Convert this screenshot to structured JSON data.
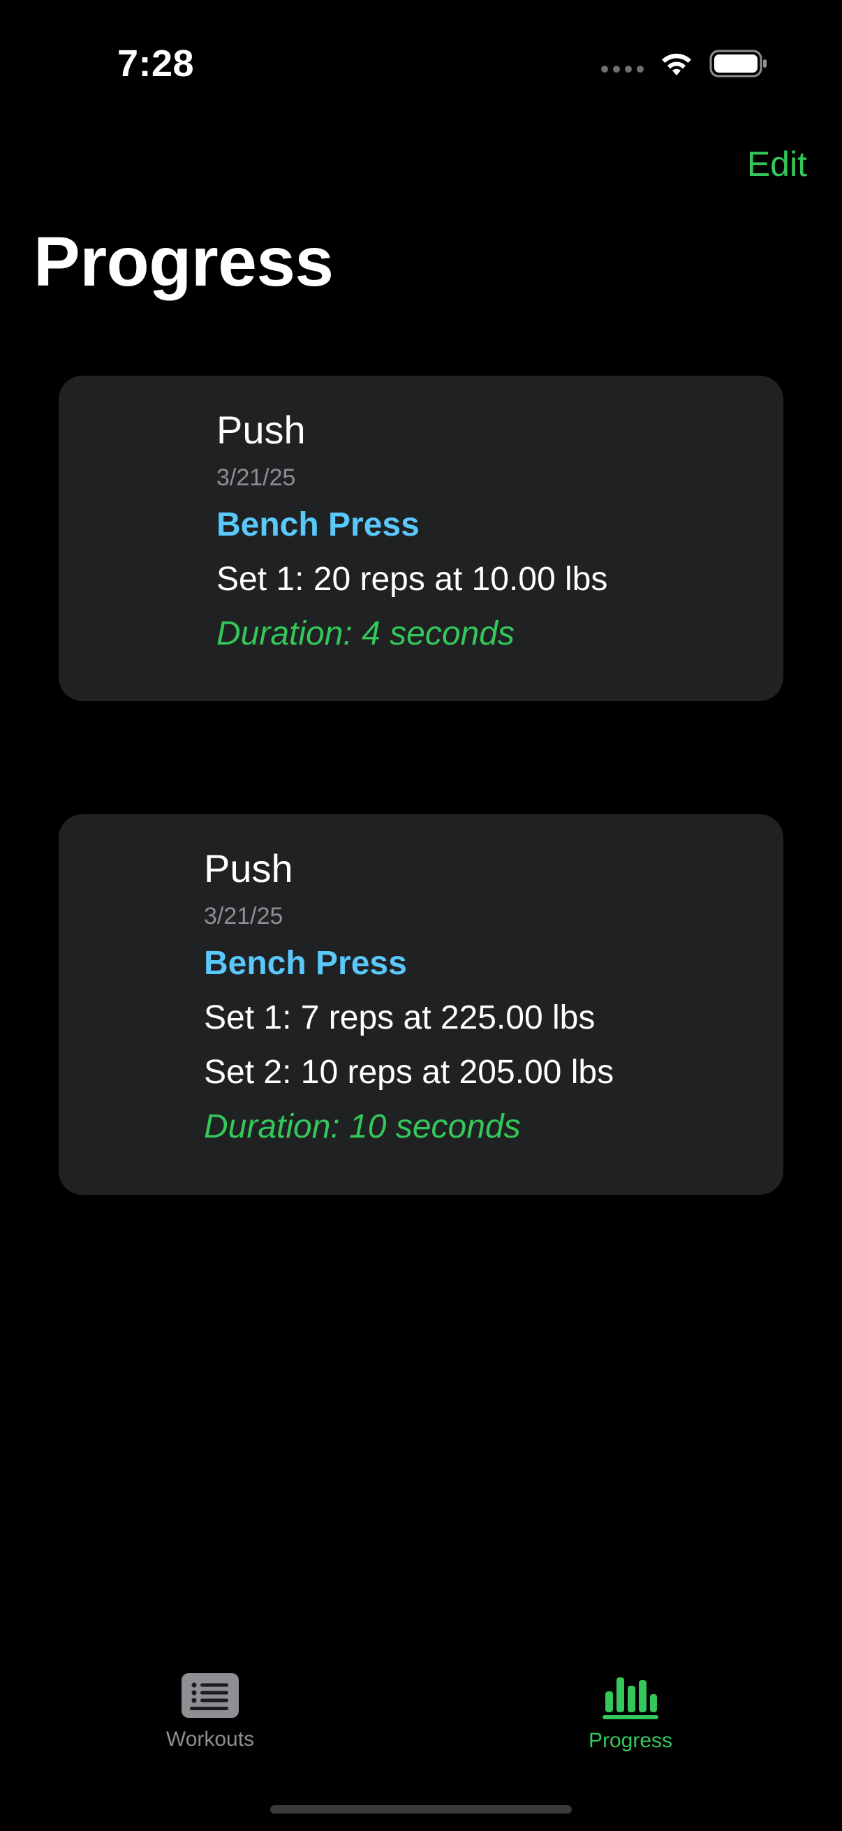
{
  "status_bar": {
    "time": "7:28"
  },
  "nav": {
    "edit_label": "Edit",
    "title": "Progress"
  },
  "cards": [
    {
      "workout": "Push",
      "date": "3/21/25",
      "exercise": "Bench Press",
      "sets": [
        "Set 1: 20 reps at 10.00 lbs"
      ],
      "duration": "Duration: 4 seconds"
    },
    {
      "workout": "Push",
      "date": "3/21/25",
      "exercise": "Bench Press",
      "sets": [
        "Set 1: 7 reps at 225.00 lbs",
        "Set 2: 10 reps at 205.00 lbs"
      ],
      "duration": "Duration: 10 seconds"
    }
  ],
  "tab_bar": {
    "tabs": [
      {
        "label": "Workouts",
        "icon": "list-icon",
        "selected": false
      },
      {
        "label": "Progress",
        "icon": "bar-chart-icon",
        "selected": true
      }
    ]
  },
  "colors": {
    "accent": "#34c759",
    "exercise": "#5ac8fa",
    "card_bg": "#1f2123",
    "secondary_text": "#8e8e93"
  }
}
